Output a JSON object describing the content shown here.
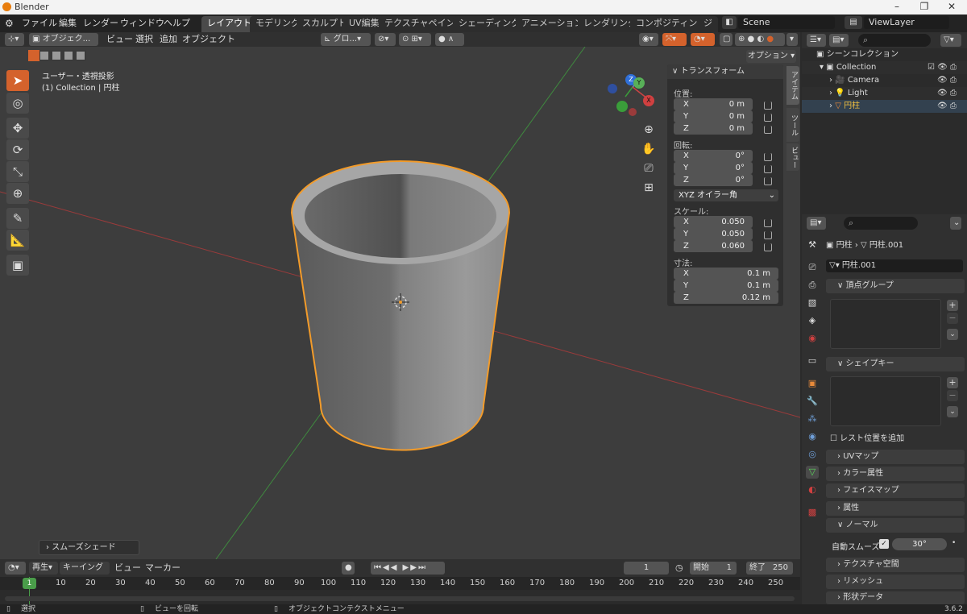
{
  "window": {
    "title": "Blender",
    "controls": [
      "–",
      "❐",
      "✕"
    ]
  },
  "menus": [
    "ファイル",
    "編集",
    "レンダー",
    "ウィンドウ",
    "ヘルプ"
  ],
  "workspaces": [
    "レイアウト",
    "モデリング",
    "スカルプト",
    "UV編集",
    "テクスチャペイント",
    "シェーディング",
    "アニメーション",
    "レンダリング",
    "コンポジティング",
    "ジ"
  ],
  "scene": "Scene",
  "view_layer": "ViewLayer",
  "viewport_header": {
    "mode": "オブジェク...",
    "menus": [
      "ビュー",
      "選択",
      "追加",
      "オブジェクト"
    ],
    "transform_orientation": "グロ...",
    "options": "オプション"
  },
  "viewport": {
    "line1": "ユーザー・透視投影",
    "line2": "(1) Collection | 円柱",
    "last_op": "スムーズシェード",
    "gizmo_labels": [
      "X",
      "Y",
      "Z"
    ],
    "nav_icons": [
      "zoom-icon",
      "hand-icon",
      "camera-icon",
      "grid-icon"
    ]
  },
  "npanel": {
    "title": "トランスフォーム",
    "location_label": "位置:",
    "location": [
      {
        "axis": "X",
        "value": "0 m"
      },
      {
        "axis": "Y",
        "value": "0 m"
      },
      {
        "axis": "Z",
        "value": "0 m"
      }
    ],
    "rotation_label": "回転:",
    "rotation": [
      {
        "axis": "X",
        "value": "0°"
      },
      {
        "axis": "Y",
        "value": "0°"
      },
      {
        "axis": "Z",
        "value": "0°"
      }
    ],
    "rotation_mode": "XYZ オイラー角",
    "scale_label": "スケール:",
    "scale": [
      {
        "axis": "X",
        "value": "0.050"
      },
      {
        "axis": "Y",
        "value": "0.050"
      },
      {
        "axis": "Z",
        "value": "0.060"
      }
    ],
    "dimensions_label": "寸法:",
    "dimensions": [
      {
        "axis": "X",
        "value": "0.1 m"
      },
      {
        "axis": "Y",
        "value": "0.1 m"
      },
      {
        "axis": "Z",
        "value": "0.12 m"
      }
    ],
    "tabs": [
      "アイテム",
      "ツール",
      "ビュー"
    ]
  },
  "outliner": {
    "title": "シーンコレクション",
    "items": [
      {
        "name": "Collection",
        "color": "#dddddd"
      },
      {
        "name": "Camera",
        "color": "#dddddd"
      },
      {
        "name": "Light",
        "color": "#dddddd"
      },
      {
        "name": "円柱",
        "color": "#f0c040"
      }
    ]
  },
  "properties": {
    "breadcrumb_object": "円柱",
    "breadcrumb_mesh": "円柱.001",
    "mesh_name": "円柱.001",
    "sections": {
      "vertex_groups": "頂点グループ",
      "shape_keys": "シェイプキー",
      "relative": "レスト位置を追加",
      "uv_maps": "UVマップ",
      "color_attr": "カラー属性",
      "face_maps": "フェイスマップ",
      "attributes": "属性",
      "normals": "ノーマル",
      "auto_smooth_label": "自動スムーズ",
      "auto_smooth_angle": "30°",
      "texture_space": "テクスチャ空間",
      "remesh": "リメッシュ",
      "shape_data": "形状データ"
    }
  },
  "timeline": {
    "menus": [
      "再生",
      "キーイング",
      "ビュー",
      "マーカー"
    ],
    "current_frame": "1",
    "start_label": "開始",
    "start": "1",
    "end_label": "終了",
    "end": "250",
    "ticks": [
      "1",
      "10",
      "20",
      "30",
      "40",
      "50",
      "60",
      "70",
      "80",
      "90",
      "100",
      "110",
      "120",
      "130",
      "140",
      "150",
      "160",
      "170",
      "180",
      "190",
      "200",
      "210",
      "220",
      "230",
      "240",
      "250"
    ]
  },
  "status": {
    "select": "選択",
    "rotate": "ビューを回転",
    "context": "オブジェクトコンテクストメニュー",
    "version": "3.6.2"
  }
}
